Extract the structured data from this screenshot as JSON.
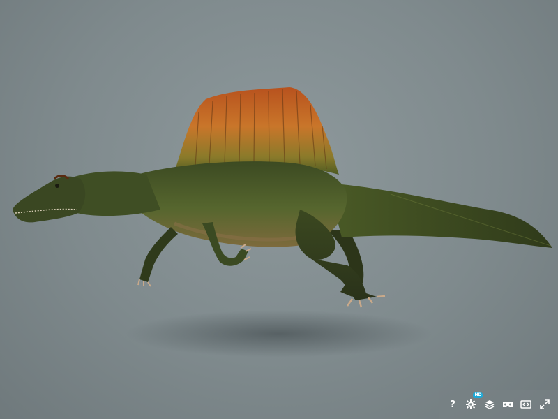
{
  "viewer": {
    "background": "#7f8a8d",
    "model_subject": "spinosaurus-3d-model"
  },
  "toolbar": {
    "help": {
      "icon": "question-mark-icon",
      "label": "?"
    },
    "settings": {
      "icon": "gear-icon",
      "badge": "HD",
      "badge_color": "#1caad9"
    },
    "layers": {
      "icon": "layers-icon"
    },
    "vr": {
      "icon": "vr-headset-icon"
    },
    "embed": {
      "icon": "embed-icon"
    },
    "fullscreen": {
      "icon": "fullscreen-icon"
    }
  }
}
